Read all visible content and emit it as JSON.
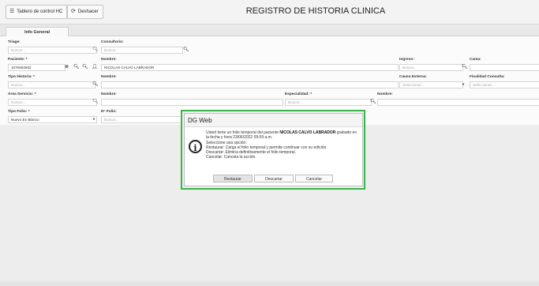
{
  "toolbar": {
    "board_label": "Tablero de control HC",
    "undo_label": "Deshacer",
    "title": "REGISTRO DE HISTORIA CLINICA"
  },
  "tabs": [
    {
      "label": "Info General"
    }
  ],
  "form": {
    "triage": {
      "label": "Triage:",
      "placeholder": "Buscar..."
    },
    "consultorio": {
      "label": "Consultorio:",
      "placeholder": "Buscar..."
    },
    "paciente": {
      "label": "Paciente: *",
      "value": "1070602502"
    },
    "nombre_paciente": {
      "label": "Nombre:",
      "value": "NICOLAS CALVO LABRADOR"
    },
    "ingreso": {
      "label": "Ingreso:",
      "placeholder": "Buscar..."
    },
    "cama": {
      "label": "Cama:"
    },
    "tipo_historia": {
      "label": "Tipo Historia: *",
      "placeholder": "Buscar..."
    },
    "nombre_historia": {
      "label": "Nombre:"
    },
    "causa_externa": {
      "label": "Causa Externa:",
      "placeholder": "Seleccionar..."
    },
    "finalidad": {
      "label": "Finalidad Consulta:",
      "placeholder": "Seleccionar..."
    },
    "area_servicio": {
      "label": "Area Servicio: *",
      "placeholder": "Buscar..."
    },
    "nombre_area": {
      "label": "Nombre:"
    },
    "especialidad": {
      "label": "Especialidad: *",
      "placeholder": "Buscar..."
    },
    "nombre_especialidad": {
      "label": "Nombre:"
    },
    "tipo_folio": {
      "label": "Tipo Folio: *",
      "value": "Nuevo En Blanco"
    },
    "n_folio": {
      "label": "N° Folio:",
      "placeholder": "Buscar..."
    }
  },
  "dialog": {
    "title": "DG Web",
    "message_prefix": "Usted tiene un folio temporal del paciente ",
    "patient_name": "NICOLAS CALVO LABRADOR",
    "message_suffix": " grabado en la fecha y hora 23/06/2022 09:59 a.m.",
    "line_select": "Seleccione una opción:",
    "line_restore": "Restaurar: Carga el folio temporal y permite continuar con su edición.",
    "line_discard": "Descartar: Elimina definitivamente el folio temporal.",
    "line_cancel": "Cancelar: Cancela la acción.",
    "buttons": {
      "restore": "Restaurar",
      "discard": "Descartar",
      "cancel": "Cancelar"
    }
  },
  "colors": {
    "dialog_highlight": "#3ab34a"
  }
}
